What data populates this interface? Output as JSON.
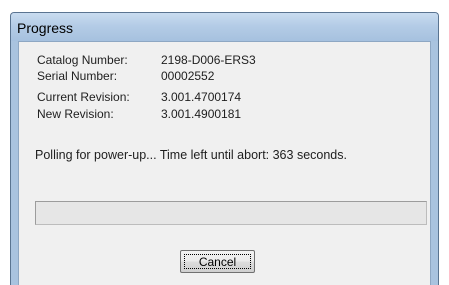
{
  "window": {
    "title": "Progress"
  },
  "info": {
    "catalog_label": "Catalog Number:",
    "catalog_value": "2198-D006-ERS3",
    "serial_label": "Serial Number:",
    "serial_value": "00002552",
    "current_label": "Current Revision:",
    "current_value": "3.001.4700174",
    "new_label": "New Revision:",
    "new_value": "3.001.4900181"
  },
  "status": {
    "message": "Polling for power-up... Time left until abort: 363 seconds."
  },
  "progress": {
    "fraction": 0
  },
  "buttons": {
    "cancel": "Cancel"
  },
  "colors": {
    "titlebar": "#b4cce6",
    "client": "#f0f0f0",
    "progress_fill": "#06b025"
  }
}
